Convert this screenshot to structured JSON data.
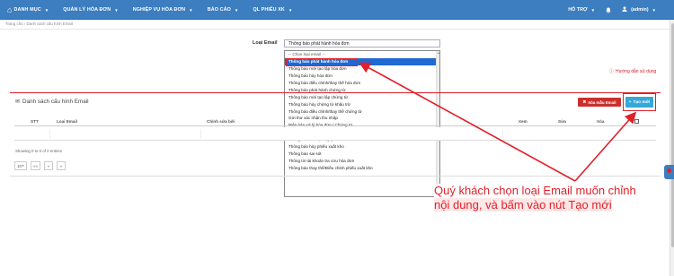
{
  "topbar": {
    "nav": [
      {
        "label": "DANH MỤC",
        "icon": "home-icon"
      },
      {
        "label": "QUẢN LÝ HÓA ĐƠN"
      },
      {
        "label": "NGHIỆP VỤ HÓA ĐƠN"
      },
      {
        "label": "BÁO CÁO"
      },
      {
        "label": "QL PHIẾU XK"
      }
    ],
    "support_label": "HỖ TRỢ",
    "bell_icon": "bell-icon",
    "user_label": "(admin)"
  },
  "breadcrumb": "Trang chủ  ›  Danh sách cấu hình Email",
  "form": {
    "email_label": "Loại Email",
    "email_value": "Thông báo phát hành hóa đơn"
  },
  "dropdown": {
    "options": [
      "-- Chọn loại email --",
      "Thông báo phát hành hóa đơn",
      "Thông báo mời tạo lập hóa đơn",
      "Thông báo hủy hóa đơn",
      "Thông báo điều chỉnh/thay thế hóa đơn",
      "Thông báo phát hành chứng từ",
      "Thông báo mời tạo lập chứng từ",
      "Thông báo hủy chứng từ khấu trừ",
      "Thông báo điều chỉnh/thay thế chứng từ",
      "Gửi thư xác nhận thu nhập",
      "Biên bản xử lý hóa đơn / Chứng từ",
      "Thông báo phát hành phiếu xuất kho",
      "Thông báo mời tạo lập phiếu xuất kho",
      "Thông báo hủy phiếu xuất kho",
      "Thông báo sai sót",
      "Thông tin tài khoản tra cứu hóa đơn",
      "Thông báo thay thế/Điều chỉnh phiếu xuất kho"
    ],
    "selected_index": 1
  },
  "guide_link": "Hướng dẫn sử dụng",
  "panel": {
    "title": "Danh sách cấu hình Email",
    "delete_button": "Xóa mẫu Email",
    "create_button": "Tạo mới"
  },
  "table": {
    "headers": [
      "STT",
      "Loại Email",
      "Chỉnh sửa bởi",
      "Xem",
      "Sửa",
      "Xóa"
    ]
  },
  "showing": "Showing 0 to 0 of 0 entries",
  "pager": {
    "page_size": "10",
    "first": "««",
    "prev": "«",
    "next": "»"
  },
  "annotation": {
    "line1": "Quý khách chọn loại Email muốn chỉnh",
    "line2": "nội dung, và bấm vào nút Tạo mới"
  },
  "colors": {
    "topbar": "#3c7ebf",
    "accent_red": "#e0202a",
    "selected_option": "#1e69d2",
    "create_button": "#35a7d8",
    "delete_button": "#c9302c"
  }
}
